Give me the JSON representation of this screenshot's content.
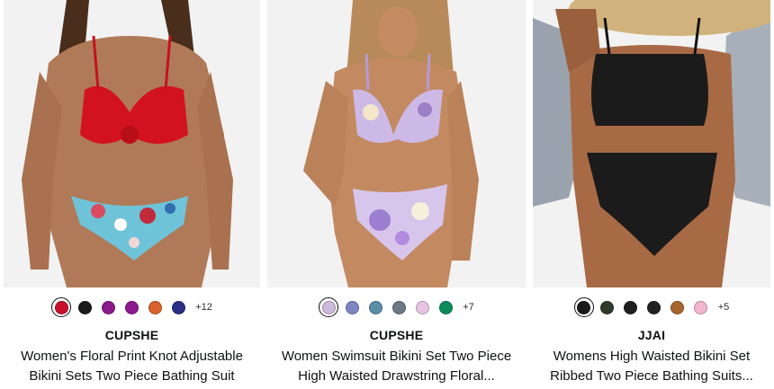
{
  "products": [
    {
      "brand": "CUPSHE",
      "title_line1": "Women's Floral Print Knot Adjustable",
      "title_line2": "Bikini Sets Two Piece Bathing Suit",
      "image_alt": "Red knot top bikini with floral blue bottom",
      "swatches": [
        "#c8102e",
        "#1a1a1a",
        "#8b1a8b",
        "#8e1a90",
        "#d9622b",
        "#2b2f86"
      ],
      "more_colors": "+12"
    },
    {
      "brand": "CUPSHE",
      "title_line1": "Women Swimsuit Bikini Set Two Piece",
      "title_line2": "High Waisted Drawstring Floral...",
      "image_alt": "Lavender floral high waisted bikini",
      "swatches": [
        "#cdb9db",
        "#7d86c2",
        "#5a8ea6",
        "#6c7a88",
        "#e7c6e3",
        "#0a8c5a"
      ],
      "more_colors": "+7"
    },
    {
      "brand": "JJAI",
      "title_line1": "Womens High Waisted Bikini Set",
      "title_line2": "Ribbed Two Piece Bathing Suits...",
      "image_alt": "Black ribbed high waisted bikini with straw hat",
      "swatches": [
        "#1a1a1a",
        "#2f3b2a",
        "#1f1f1f",
        "#222222",
        "#a9652e",
        "#f2b6cf"
      ],
      "more_colors": "+5"
    }
  ]
}
